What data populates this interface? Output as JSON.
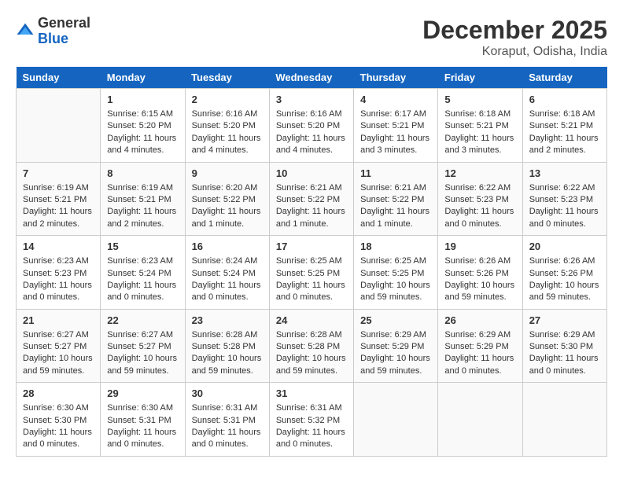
{
  "header": {
    "logo_general": "General",
    "logo_blue": "Blue",
    "month": "December 2025",
    "location": "Koraput, Odisha, India"
  },
  "days_of_week": [
    "Sunday",
    "Monday",
    "Tuesday",
    "Wednesday",
    "Thursday",
    "Friday",
    "Saturday"
  ],
  "weeks": [
    [
      {
        "day": "",
        "info": ""
      },
      {
        "day": "1",
        "info": "Sunrise: 6:15 AM\nSunset: 5:20 PM\nDaylight: 11 hours\nand 4 minutes."
      },
      {
        "day": "2",
        "info": "Sunrise: 6:16 AM\nSunset: 5:20 PM\nDaylight: 11 hours\nand 4 minutes."
      },
      {
        "day": "3",
        "info": "Sunrise: 6:16 AM\nSunset: 5:20 PM\nDaylight: 11 hours\nand 4 minutes."
      },
      {
        "day": "4",
        "info": "Sunrise: 6:17 AM\nSunset: 5:21 PM\nDaylight: 11 hours\nand 3 minutes."
      },
      {
        "day": "5",
        "info": "Sunrise: 6:18 AM\nSunset: 5:21 PM\nDaylight: 11 hours\nand 3 minutes."
      },
      {
        "day": "6",
        "info": "Sunrise: 6:18 AM\nSunset: 5:21 PM\nDaylight: 11 hours\nand 2 minutes."
      }
    ],
    [
      {
        "day": "7",
        "info": "Sunrise: 6:19 AM\nSunset: 5:21 PM\nDaylight: 11 hours\nand 2 minutes."
      },
      {
        "day": "8",
        "info": "Sunrise: 6:19 AM\nSunset: 5:21 PM\nDaylight: 11 hours\nand 2 minutes."
      },
      {
        "day": "9",
        "info": "Sunrise: 6:20 AM\nSunset: 5:22 PM\nDaylight: 11 hours\nand 1 minute."
      },
      {
        "day": "10",
        "info": "Sunrise: 6:21 AM\nSunset: 5:22 PM\nDaylight: 11 hours\nand 1 minute."
      },
      {
        "day": "11",
        "info": "Sunrise: 6:21 AM\nSunset: 5:22 PM\nDaylight: 11 hours\nand 1 minute."
      },
      {
        "day": "12",
        "info": "Sunrise: 6:22 AM\nSunset: 5:23 PM\nDaylight: 11 hours\nand 0 minutes."
      },
      {
        "day": "13",
        "info": "Sunrise: 6:22 AM\nSunset: 5:23 PM\nDaylight: 11 hours\nand 0 minutes."
      }
    ],
    [
      {
        "day": "14",
        "info": "Sunrise: 6:23 AM\nSunset: 5:23 PM\nDaylight: 11 hours\nand 0 minutes."
      },
      {
        "day": "15",
        "info": "Sunrise: 6:23 AM\nSunset: 5:24 PM\nDaylight: 11 hours\nand 0 minutes."
      },
      {
        "day": "16",
        "info": "Sunrise: 6:24 AM\nSunset: 5:24 PM\nDaylight: 11 hours\nand 0 minutes."
      },
      {
        "day": "17",
        "info": "Sunrise: 6:25 AM\nSunset: 5:25 PM\nDaylight: 11 hours\nand 0 minutes."
      },
      {
        "day": "18",
        "info": "Sunrise: 6:25 AM\nSunset: 5:25 PM\nDaylight: 10 hours\nand 59 minutes."
      },
      {
        "day": "19",
        "info": "Sunrise: 6:26 AM\nSunset: 5:26 PM\nDaylight: 10 hours\nand 59 minutes."
      },
      {
        "day": "20",
        "info": "Sunrise: 6:26 AM\nSunset: 5:26 PM\nDaylight: 10 hours\nand 59 minutes."
      }
    ],
    [
      {
        "day": "21",
        "info": "Sunrise: 6:27 AM\nSunset: 5:27 PM\nDaylight: 10 hours\nand 59 minutes."
      },
      {
        "day": "22",
        "info": "Sunrise: 6:27 AM\nSunset: 5:27 PM\nDaylight: 10 hours\nand 59 minutes."
      },
      {
        "day": "23",
        "info": "Sunrise: 6:28 AM\nSunset: 5:28 PM\nDaylight: 10 hours\nand 59 minutes."
      },
      {
        "day": "24",
        "info": "Sunrise: 6:28 AM\nSunset: 5:28 PM\nDaylight: 10 hours\nand 59 minutes."
      },
      {
        "day": "25",
        "info": "Sunrise: 6:29 AM\nSunset: 5:29 PM\nDaylight: 10 hours\nand 59 minutes."
      },
      {
        "day": "26",
        "info": "Sunrise: 6:29 AM\nSunset: 5:29 PM\nDaylight: 11 hours\nand 0 minutes."
      },
      {
        "day": "27",
        "info": "Sunrise: 6:29 AM\nSunset: 5:30 PM\nDaylight: 11 hours\nand 0 minutes."
      }
    ],
    [
      {
        "day": "28",
        "info": "Sunrise: 6:30 AM\nSunset: 5:30 PM\nDaylight: 11 hours\nand 0 minutes."
      },
      {
        "day": "29",
        "info": "Sunrise: 6:30 AM\nSunset: 5:31 PM\nDaylight: 11 hours\nand 0 minutes."
      },
      {
        "day": "30",
        "info": "Sunrise: 6:31 AM\nSunset: 5:31 PM\nDaylight: 11 hours\nand 0 minutes."
      },
      {
        "day": "31",
        "info": "Sunrise: 6:31 AM\nSunset: 5:32 PM\nDaylight: 11 hours\nand 0 minutes."
      },
      {
        "day": "",
        "info": ""
      },
      {
        "day": "",
        "info": ""
      },
      {
        "day": "",
        "info": ""
      }
    ]
  ]
}
